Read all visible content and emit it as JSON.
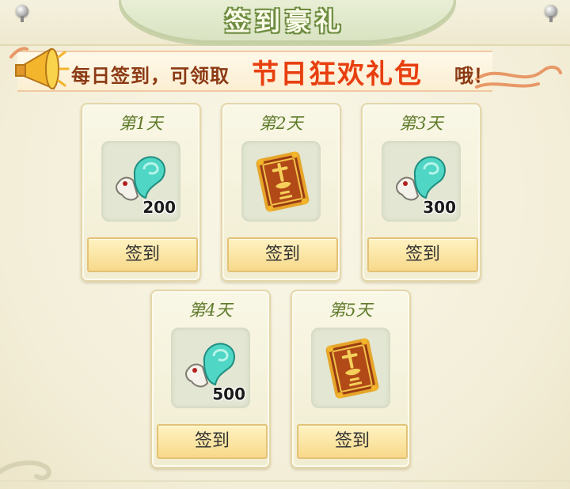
{
  "header": {
    "title": "签到豪礼"
  },
  "banner": {
    "lead": "每日签到，可领取",
    "highlight": "节日狂欢礼包",
    "tail": "哦！"
  },
  "days": [
    {
      "label": "第1天",
      "item": "jade-scroll-icon",
      "count": "200",
      "button": "签到"
    },
    {
      "label": "第2天",
      "item": "golden-book-icon",
      "count": "",
      "button": "签到"
    },
    {
      "label": "第3天",
      "item": "jade-scroll-icon",
      "count": "300",
      "button": "签到"
    },
    {
      "label": "第4天",
      "item": "jade-scroll-icon",
      "count": "500",
      "button": "签到"
    },
    {
      "label": "第5天",
      "item": "golden-book-icon",
      "count": "",
      "button": "签到"
    }
  ],
  "colors": {
    "accent": "#e83f10",
    "day_label": "#5e7a2a",
    "button_fill": "#f7d98a"
  }
}
